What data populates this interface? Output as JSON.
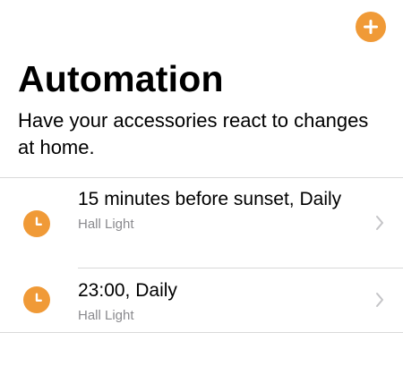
{
  "header": {
    "title": "Automation",
    "subtitle": "Have your accessories react to changes at home.",
    "add_icon": "plus-circle-icon"
  },
  "automations": [
    {
      "title": "15 minutes before sunset, Daily",
      "accessory": "Hall Light",
      "icon": "clock-icon"
    },
    {
      "title": "23:00, Daily",
      "accessory": "Hall Light",
      "icon": "clock-icon"
    }
  ],
  "colors": {
    "accent": "#f09a37",
    "secondary_text": "#8a8a8e",
    "separator": "#d9d9d9",
    "chevron": "#c4c4c7"
  }
}
